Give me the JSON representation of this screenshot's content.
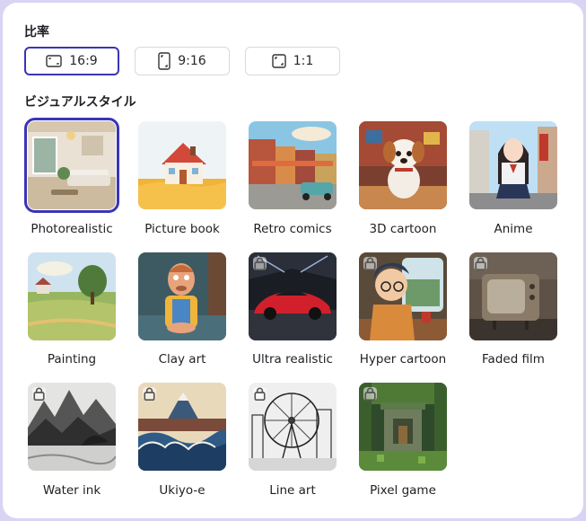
{
  "ratio_section": {
    "title": "比率",
    "options": [
      {
        "label": "16:9",
        "icon": "landscape-icon",
        "active": true
      },
      {
        "label": "9:16",
        "icon": "portrait-icon",
        "active": false
      },
      {
        "label": "1:1",
        "icon": "square-icon",
        "active": false
      }
    ]
  },
  "style_section": {
    "title": "ビジュアルスタイル",
    "styles": [
      {
        "label": "Photorealistic",
        "locked": false,
        "selected": true
      },
      {
        "label": "Picture book",
        "locked": false
      },
      {
        "label": "Retro comics",
        "locked": false
      },
      {
        "label": "3D cartoon",
        "locked": false
      },
      {
        "label": "Anime",
        "locked": false
      },
      {
        "label": "Painting",
        "locked": false
      },
      {
        "label": "Clay art",
        "locked": false
      },
      {
        "label": "Ultra realistic",
        "locked": true
      },
      {
        "label": "Hyper cartoon",
        "locked": true
      },
      {
        "label": "Faded film",
        "locked": true
      },
      {
        "label": "Water ink",
        "locked": true
      },
      {
        "label": "Ukiyo-e",
        "locked": true
      },
      {
        "label": "Line art",
        "locked": true
      },
      {
        "label": "Pixel game",
        "locked": true
      }
    ]
  },
  "colors": {
    "accent": "#3a35b5",
    "frame": "#d9d4f3"
  }
}
